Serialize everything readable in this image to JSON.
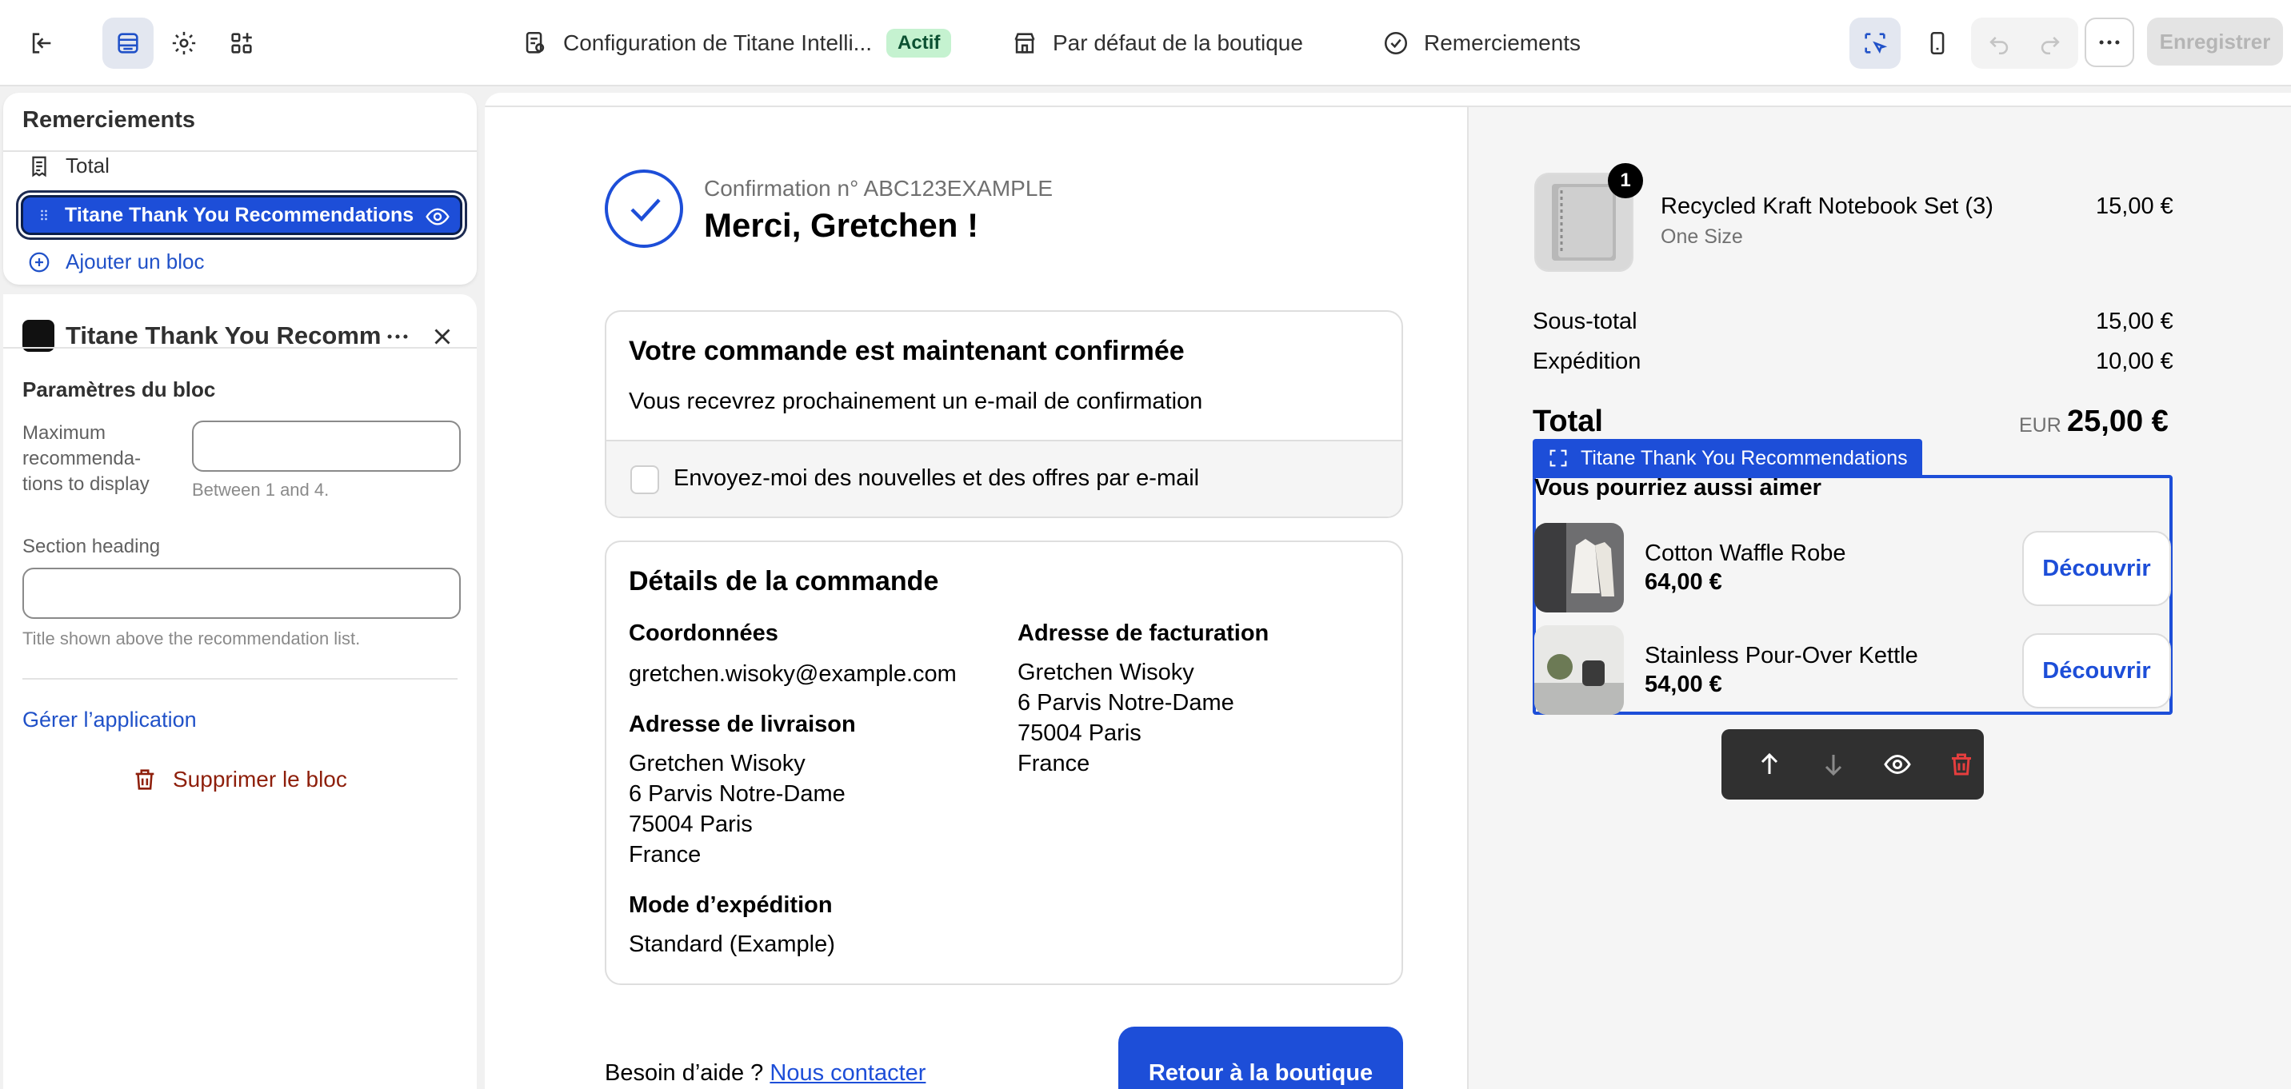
{
  "topbar": {
    "breadcrumb_app": "Configuration de Titane Intelli...",
    "status_badge": "Actif",
    "breadcrumb_store": "Par défaut de la boutique",
    "breadcrumb_page": "Remerciements",
    "save_label": "Enregistrer"
  },
  "sidebar": {
    "title": "Remerciements",
    "items": [
      {
        "label": "Total",
        "icon": "receipt-icon"
      },
      {
        "label": "Titane Thank You Recommendations",
        "icon": "drag-handle-icon",
        "selected": true
      }
    ],
    "add_block": "Ajouter un bloc"
  },
  "block_settings": {
    "app_title": "Titane Thank You Recomm",
    "section_title": "Paramètres du bloc",
    "max_label_lines": [
      "Maximum",
      "recommenda-",
      "tions to display"
    ],
    "max_value": "",
    "max_help": "Between 1 and 4.",
    "heading_label": "Section heading",
    "heading_value": "",
    "heading_help": "Title shown above the recommendation list.",
    "manage_app": "Gérer l’application",
    "delete_block": "Supprimer le bloc"
  },
  "confirmation": {
    "number": "Confirmation n° ABC123EXAMPLE",
    "thanks": "Merci, Gretchen !",
    "confirmed_title": "Votre commande est maintenant confirmée",
    "confirmed_text": "Vous recevrez prochainement un e-mail de confirmation",
    "newsletter": "Envoyez-moi des nouvelles et des offres par e-mail",
    "details_title": "Détails de la commande",
    "contact_label": "Coordonnées",
    "contact_email": "gretchen.wisoky@example.com",
    "shipping_label": "Adresse de livraison",
    "shipping_lines": [
      "Gretchen Wisoky",
      "6 Parvis Notre-Dame",
      "75004 Paris",
      "France"
    ],
    "billing_label": "Adresse de facturation",
    "billing_lines": [
      "Gretchen Wisoky",
      "6 Parvis Notre-Dame",
      "75004 Paris",
      "France"
    ],
    "method_label": "Mode d’expédition",
    "method_value": "Standard (Example)",
    "help_prefix": "Besoin d’aide ?",
    "help_link": "Nous contacter",
    "return_button": "Retour à la boutique"
  },
  "summary": {
    "product_name": "Recycled Kraft Notebook Set (3)",
    "product_variant": "One Size",
    "product_price": "15,00 €",
    "product_qty": "1",
    "subtotal_label": "Sous-total",
    "subtotal_value": "15,00 €",
    "shipping_label": "Expédition",
    "shipping_value": "10,00 €",
    "total_label": "Total",
    "total_currency": "EUR",
    "total_value": "25,00 €"
  },
  "recommendations": {
    "tag": "Titane Thank You Recommendations",
    "heading": "Vous pourriez aussi aimer",
    "items": [
      {
        "name": "Cotton Waffle Robe",
        "price": "64,00 €",
        "cta": "Découvrir"
      },
      {
        "name": "Stainless Pour-Over Kettle",
        "price": "54,00 €",
        "cta": "Découvrir"
      }
    ]
  },
  "colors": {
    "accent": "#1d4ed8",
    "badge_bg": "#c5f2d0",
    "danger": "#8e1f0b",
    "toolbar_dark": "#303030"
  }
}
